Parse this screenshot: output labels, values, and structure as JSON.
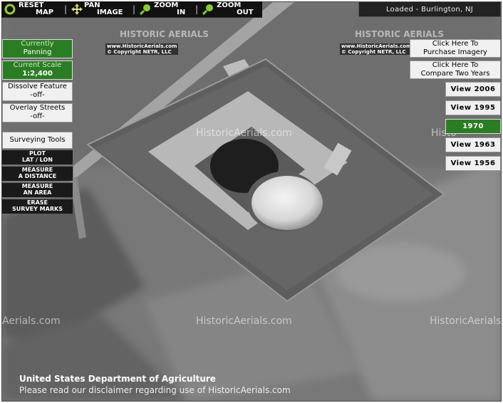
{
  "toolbar": {
    "reset": {
      "l1": "RESET",
      "l2": "MAP"
    },
    "pan": {
      "l1": "PAN",
      "l2": "IMAGE"
    },
    "zoom_in": {
      "l1": "ZOOM",
      "l2": "IN"
    },
    "zoom_out": {
      "l1": "ZOOM",
      "l2": "OUT"
    },
    "separator": "|"
  },
  "status": {
    "loaded": "Loaded - Burlington, NJ"
  },
  "left_panel": {
    "currently": {
      "label": "Currently",
      "value": "Panning"
    },
    "scale": {
      "label": "Current Scale",
      "value": "1:2,400"
    },
    "dissolve": {
      "label": "Dissolve Feature",
      "value": "-off-"
    },
    "overlay": {
      "label": "Overlay Streets",
      "value": "-off-"
    },
    "surveying_title": "Surveying Tools",
    "tools": [
      {
        "l1": "PLOT",
        "l2": "LAT / LON"
      },
      {
        "l1": "MEASURE",
        "l2": "A DISTANCE"
      },
      {
        "l1": "MEASURE",
        "l2": "AN AREA"
      },
      {
        "l1": "ERASE",
        "l2": "SURVEY MARKS"
      }
    ]
  },
  "right_panel": {
    "purchase": {
      "l1": "Click Here To",
      "l2": "Purchase Imagery"
    },
    "compare": {
      "l1": "Click Here To",
      "l2": "Compare Two Years"
    },
    "years": [
      {
        "label": "View 2006",
        "active": false
      },
      {
        "label": "View 1995",
        "active": false
      },
      {
        "label": "1970",
        "active": true
      },
      {
        "label": "View 1963",
        "active": false
      },
      {
        "label": "View 1956",
        "active": false
      }
    ]
  },
  "watermarks": {
    "logo_text": "HISTORIC AERIALS",
    "site": "HistoricAerials.com",
    "site_cut": "Aerials.com",
    "site_cut2": "HistoricAerials",
    "site_cut3": "Histo",
    "stamp1": "www.HistoricAerials.com",
    "stamp2": "© Copyright NETR, LLC"
  },
  "footer": {
    "line1": "United States Department of Agriculture",
    "line2": "Please read our disclaimer regarding use of HistoricAerials.com"
  },
  "colors": {
    "green": "#2a7d22",
    "panel": "#f0f0f0",
    "toolbar": "#111111"
  }
}
